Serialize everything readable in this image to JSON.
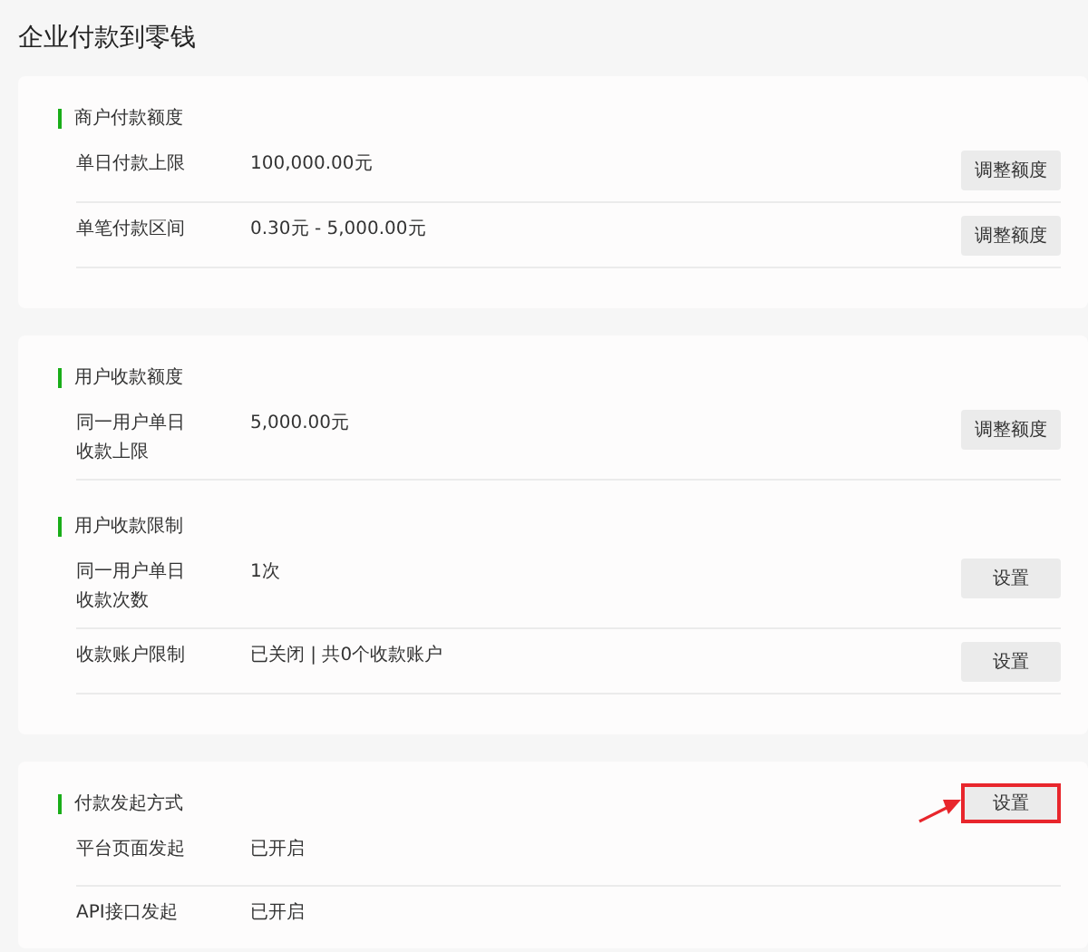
{
  "page_title": "企业付款到零钱",
  "cards": [
    {
      "sections": [
        {
          "heading": "商户付款额度",
          "rows": [
            {
              "label": "单日付款上限",
              "value": "100,000.00元",
              "button": {
                "label": "调整额度"
              }
            },
            {
              "label": "单笔付款区间",
              "value": "0.30元 - 5,000.00元",
              "button": {
                "label": "调整额度"
              }
            }
          ]
        }
      ]
    },
    {
      "sections": [
        {
          "heading": "用户收款额度",
          "rows": [
            {
              "label": "同一用户单日收款上限",
              "value": "5,000.00元",
              "button": {
                "label": "调整额度"
              }
            }
          ]
        },
        {
          "heading": "用户收款限制",
          "rows": [
            {
              "label": "同一用户单日收款次数",
              "value": "1次",
              "button": {
                "label": "设置"
              }
            },
            {
              "label": "收款账户限制",
              "value": "已关闭 | 共0个收款账户",
              "button": {
                "label": "设置"
              }
            }
          ]
        }
      ]
    },
    {
      "sections": [
        {
          "heading": "付款发起方式",
          "button": {
            "label": "设置",
            "highlighted": true
          },
          "rows": [
            {
              "label": "平台页面发起",
              "value": "已开启"
            },
            {
              "label": "API接口发起",
              "value": "已开启"
            }
          ]
        }
      ]
    }
  ]
}
